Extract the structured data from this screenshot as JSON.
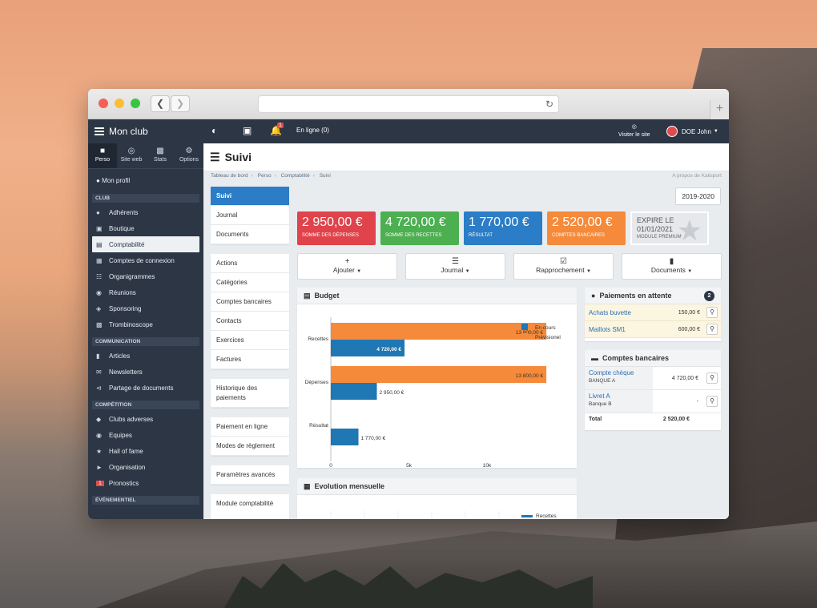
{
  "topbar": {
    "brand": "Mon club",
    "online": "En ligne (0)",
    "notif_count": "1",
    "visit": "Visiter le site",
    "user": "DOE John"
  },
  "sidebar": {
    "tabs": [
      {
        "label": "Perso",
        "icon": "user-card-icon"
      },
      {
        "label": "Site web",
        "icon": "globe-icon"
      },
      {
        "label": "Stats",
        "icon": "bar-chart-icon"
      },
      {
        "label": "Options",
        "icon": "gears-icon"
      }
    ],
    "profile": "Mon profil",
    "sections": {
      "club": "CLUB",
      "communication": "COMMUNICATION",
      "competition": "COMPÉTITION",
      "evenementiel": "ÉVÉNEMENTIEL"
    },
    "club_items": [
      "Adhérents",
      "Boutique",
      "Comptabilité",
      "Comptes de connexion",
      "Organigrammes",
      "Réunions",
      "Sponsoring",
      "Trombinoscope"
    ],
    "comm_items": [
      "Articles",
      "Newsletters",
      "Partage de documents"
    ],
    "comp_items": [
      "Clubs adverses",
      "Equipes",
      "Hall of fame",
      "Organisation",
      "Pronostics"
    ],
    "pronostics_badge": "1"
  },
  "page": {
    "title": "Suivi",
    "crumbs": [
      "Tableau de bord",
      "Perso",
      "Comptabilité",
      "Suivi"
    ],
    "about": "A propos de Kalisport",
    "season": "2019-2020"
  },
  "subnav": {
    "g1": [
      "Suivi",
      "Journal",
      "Documents"
    ],
    "g2": [
      "Actions",
      "Catégories",
      "Comptes bancaires",
      "Contacts",
      "Exercices",
      "Factures"
    ],
    "g3": [
      "Historique des paiements"
    ],
    "g4": [
      "Paiement en ligne",
      "Modes de règlement"
    ],
    "g5": [
      "Paramètres avancés"
    ],
    "g6": [
      "Module comptabilité"
    ]
  },
  "stats": [
    {
      "value": "2 950,00 €",
      "label": "Somme des dépenses",
      "color": "#e0434b"
    },
    {
      "value": "4 720,00 €",
      "label": "Somme des recettes",
      "color": "#4caf50"
    },
    {
      "value": "1 770,00 €",
      "label": "Résultat",
      "color": "#2a7dc6"
    },
    {
      "value": "2 520,00 €",
      "label": "Comptes bancaires",
      "color": "#f58a3a"
    }
  ],
  "premium": {
    "line1": "EXPIRE LE",
    "line2": "01/01/2021",
    "label": "MODULE PREMIUM"
  },
  "actions": [
    "Ajouter",
    "Journal",
    "Rapprochement",
    "Documents"
  ],
  "budget": {
    "title": "Budget"
  },
  "evolution": {
    "title": "Evolution mensuelle",
    "legend_recettes": "Recettes"
  },
  "pending": {
    "title": "Paiements en attente",
    "count": "2",
    "rows": [
      {
        "name": "Achats buvette",
        "amount": "150,00 €"
      },
      {
        "name": "Maillots SM1",
        "amount": "600,00 €"
      }
    ]
  },
  "banks": {
    "title": "Comptes bancaires",
    "rows": [
      {
        "name": "Compte chèque",
        "bank": "BANQUE A",
        "amount": "4 720,00 €"
      },
      {
        "name": "Livret A",
        "bank": "Banque B",
        "amount": "-"
      }
    ],
    "total_label": "Total",
    "total": "2 520,00 €"
  },
  "chart_data": {
    "type": "bar",
    "orientation": "horizontal",
    "categories": [
      "Recettes",
      "Dépenses",
      "Résultat"
    ],
    "series": [
      {
        "name": "Prévisionel",
        "values": [
          13800,
          13800,
          null
        ],
        "labels": [
          "13 800,00 €",
          "13 800,00 €",
          ""
        ],
        "color": "#f58a3a"
      },
      {
        "name": "En cours",
        "values": [
          4720,
          2950,
          1770
        ],
        "labels": [
          "4 720,00 €",
          "2 950,00 €",
          "1 770,00 €"
        ],
        "color": "#1f77b4"
      }
    ],
    "xticks": [
      "0",
      "5k",
      "10k"
    ],
    "xtick_values": [
      0,
      5000,
      10000
    ],
    "xlim": [
      0,
      14000
    ],
    "legend": [
      "En cours",
      "Prévisionel"
    ],
    "legend_position": "top-right"
  }
}
